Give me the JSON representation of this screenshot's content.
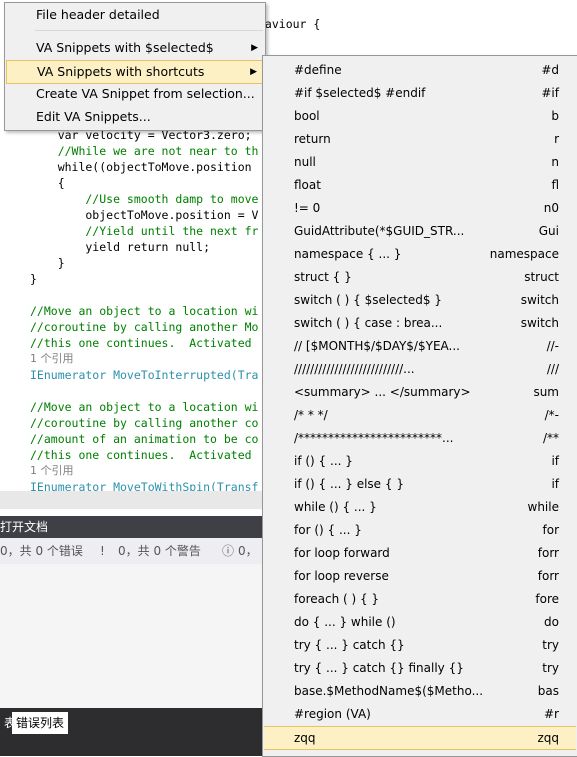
{
  "editor": {
    "lines": [
      {
        "text": "haviour {",
        "cls": ""
      },
      {
        "text": "    var velocity = Vector3.zero;",
        "cls": ""
      },
      {
        "text": "    //While we are not near to th",
        "cls": "cmt"
      },
      {
        "text": "    while((objectToMove.position",
        "cls": ""
      },
      {
        "text": "    {",
        "cls": ""
      },
      {
        "text": "        //Use smooth damp to move",
        "cls": "cmt"
      },
      {
        "text": "        objectToMove.position = V",
        "cls": ""
      },
      {
        "text": "        //Yield until the next fr",
        "cls": "cmt"
      },
      {
        "text": "        yield return null;",
        "cls": ""
      },
      {
        "text": "    }",
        "cls": ""
      },
      {
        "text": "}",
        "cls": ""
      },
      {
        "text": "//Move an object to a location wi",
        "cls": "cmt"
      },
      {
        "text": "//coroutine by calling another Mo",
        "cls": "cmt"
      },
      {
        "text": "//this one continues.  Activated ",
        "cls": "cmt"
      },
      {
        "text": "1 个引用",
        "cls": "ref"
      },
      {
        "text": "IEnumerator MoveToInterrupted(Tra",
        "cls": "ty"
      },
      {
        "text": "//Move an object to a location wi",
        "cls": "cmt"
      },
      {
        "text": "//coroutine by calling another co",
        "cls": "cmt"
      },
      {
        "text": "//amount of an animation to be co",
        "cls": "cmt"
      },
      {
        "text": "//this one continues.  Activated ",
        "cls": "cmt"
      },
      {
        "text": "1 个引用",
        "cls": "ref"
      },
      {
        "text": "IEnumerator MoveToWithSpin(Transf",
        "cls": "ty"
      }
    ]
  },
  "error_panel": {
    "title": "打开文档",
    "errors": "0，共 0 个错误",
    "warnings": "0，共 0 个警告",
    "messages": "0，",
    "tabs": [
      "表",
      "错误列表"
    ]
  },
  "context_menu": {
    "items": [
      {
        "label": "File header detailed",
        "underline": "F"
      },
      {
        "label": "VA Snippets with $selected$",
        "underline": "V",
        "submenu": true
      },
      {
        "label": "VA Snippets with shortcuts",
        "underline": "A",
        "submenu": true,
        "highlighted": true
      },
      {
        "label": "Create VA Snippet from selection...",
        "underline": "C"
      },
      {
        "label": "Edit VA Snippets...",
        "underline": "E"
      }
    ]
  },
  "submenu": {
    "items": [
      {
        "label": "#define",
        "shortcut": "#d"
      },
      {
        "label": "#if   $selected$ #endif",
        "shortcut": "#if"
      },
      {
        "label": "bool",
        "shortcut": "b"
      },
      {
        "label": "return",
        "shortcut": "r"
      },
      {
        "label": "null",
        "shortcut": "n"
      },
      {
        "label": "float",
        "shortcut": "fl"
      },
      {
        "label": "!= 0",
        "shortcut": "n0"
      },
      {
        "label": "GuidAttribute(*$GUID_STR...",
        "shortcut": "Gui"
      },
      {
        "label": "namespace { ... }",
        "shortcut": "namespace"
      },
      {
        "label": "struct   { }",
        "shortcut": "struct"
      },
      {
        "label": "switch ( ) { $selected$ }",
        "shortcut": "switch"
      },
      {
        "label": "switch ( ) { case : brea...",
        "shortcut": "switch"
      },
      {
        "label": "//   [$MONTH$/$DAY$/$YEA...",
        "shortcut": "//-"
      },
      {
        "label": "///////////////////////////...",
        "shortcut": "///"
      },
      {
        "label": "<summary> ... </summary>",
        "shortcut": "sum"
      },
      {
        "label": "/* *   */",
        "shortcut": "/*-"
      },
      {
        "label": "/************************...",
        "shortcut": "/**"
      },
      {
        "label": "if () { ... }",
        "shortcut": "if"
      },
      {
        "label": "if () { ... } else { }",
        "shortcut": "if"
      },
      {
        "label": "while () { ... }",
        "shortcut": "while"
      },
      {
        "label": "for () { ... }",
        "shortcut": "for"
      },
      {
        "label": "for loop forward",
        "shortcut": "forr"
      },
      {
        "label": "for loop reverse",
        "shortcut": "forr"
      },
      {
        "label": "foreach ( ) { }",
        "shortcut": "fore"
      },
      {
        "label": "do { ... } while ()",
        "shortcut": "do"
      },
      {
        "label": "try { ... } catch {}",
        "shortcut": "try"
      },
      {
        "label": "try { ... } catch {} finally {}",
        "shortcut": "try"
      },
      {
        "label": "base.$MethodName$($Metho...",
        "shortcut": "bas"
      },
      {
        "label": "#region (VA)",
        "shortcut": "#r"
      },
      {
        "label": "zqq",
        "shortcut": "zqq",
        "highlighted": true
      }
    ]
  }
}
